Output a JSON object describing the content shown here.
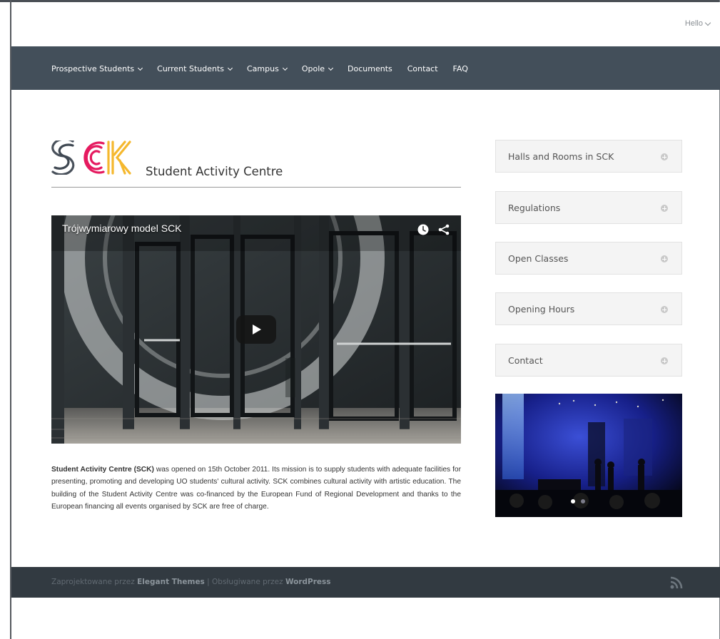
{
  "header": {
    "greeting": "Hello"
  },
  "nav": {
    "items": [
      {
        "label": "Prospective Students",
        "has_dropdown": true
      },
      {
        "label": "Current Students",
        "has_dropdown": true
      },
      {
        "label": "Campus",
        "has_dropdown": true
      },
      {
        "label": "Opole",
        "has_dropdown": true
      },
      {
        "label": "Documents",
        "has_dropdown": false
      },
      {
        "label": "Contact",
        "has_dropdown": false
      },
      {
        "label": "FAQ",
        "has_dropdown": false
      }
    ]
  },
  "brand": {
    "logo_text": "SCK",
    "subtitle": "Student Activity Centre",
    "colors": {
      "s": "#3f4852",
      "c": "#e51a5f",
      "k": "#f5b82e"
    }
  },
  "video": {
    "title": "Trójwymiarowy model SCK",
    "icons": [
      "clock-icon",
      "share-icon",
      "play-icon"
    ]
  },
  "intro": {
    "bold": "Student Activity Centre (SCK)",
    "text": " was opened on 15th October 2011. Its mission is to supply students with adequate facilities for presenting, promoting and developing UO students' cultural activity. SCK combines cultural activity with artistic education. The building of the Student Activity Centre was co-financed by the European Fund of Regional Development and thanks to the European financing all events organised by SCK are free of charge."
  },
  "accordion": {
    "items": [
      {
        "label": "Halls and Rooms in SCK"
      },
      {
        "label": "Regulations"
      },
      {
        "label": "Open Classes"
      },
      {
        "label": "Opening Hours"
      },
      {
        "label": "Contact"
      }
    ]
  },
  "slider": {
    "slide_count": 2,
    "active_index": 0
  },
  "footer": {
    "designed_prefix": "Zaprojektowane przez ",
    "designed_by": "Elegant Themes",
    "separator": " | ",
    "powered_prefix": "Obsługiwane przez ",
    "powered_by": "WordPress"
  },
  "colors": {
    "navbar": "#434f5a",
    "footer": "#323a41",
    "accordion_bg": "#f4f4f4"
  }
}
